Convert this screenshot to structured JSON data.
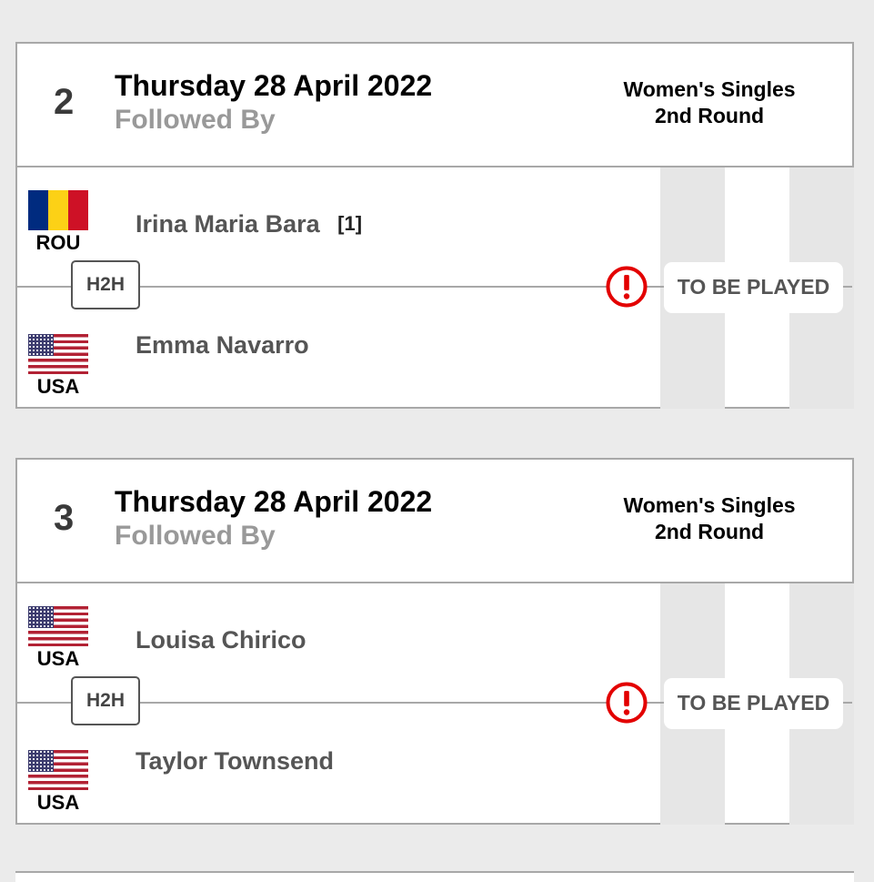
{
  "matches": [
    {
      "order": "2",
      "date": "Thursday 28 April 2022",
      "followed_by": "Followed By",
      "event_line1": "Women's Singles",
      "event_line2": "2nd Round",
      "player1": {
        "first": "Irina Maria",
        "last": "Bara",
        "seed": "[1]",
        "country": "ROU",
        "flag": "rou"
      },
      "player2": {
        "first": "Emma",
        "last": "Navarro",
        "seed": "",
        "country": "USA",
        "flag": "usa"
      },
      "h2h_label": "H2H",
      "status": "TO BE PLAYED",
      "status_icon": "alert-icon"
    },
    {
      "order": "3",
      "date": "Thursday 28 April 2022",
      "followed_by": "Followed By",
      "event_line1": "Women's Singles",
      "event_line2": "2nd Round",
      "player1": {
        "first": "Louisa",
        "last": "Chirico",
        "seed": "",
        "country": "USA",
        "flag": "usa"
      },
      "player2": {
        "first": "Taylor",
        "last": "Townsend",
        "seed": "",
        "country": "USA",
        "flag": "usa"
      },
      "h2h_label": "H2H",
      "status": "TO BE PLAYED",
      "status_icon": "alert-icon"
    }
  ],
  "colors": {
    "alert": "#e30000",
    "set_column": "#e6e6e6",
    "page_background": "#ebebeb"
  }
}
